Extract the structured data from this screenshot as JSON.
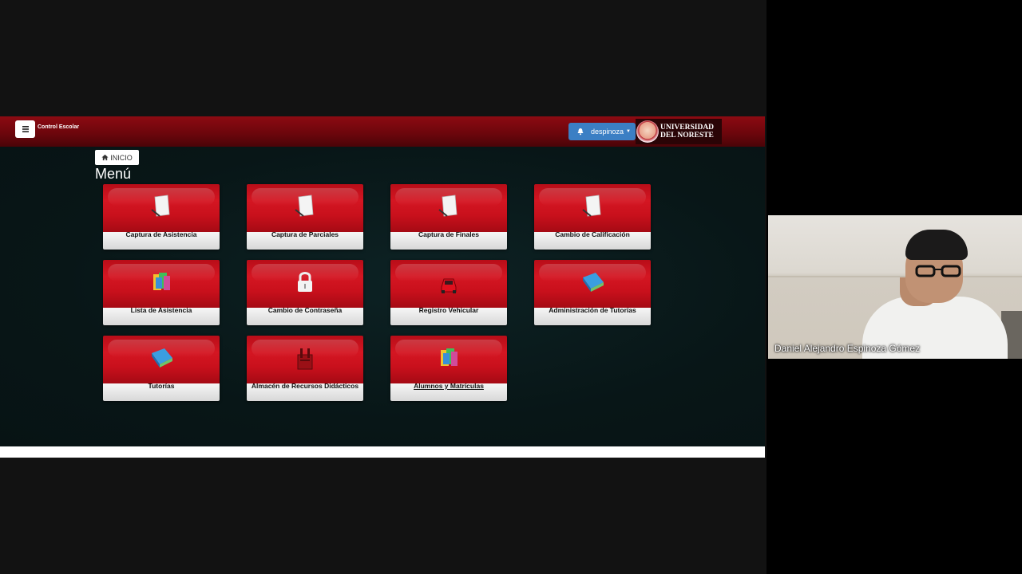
{
  "app": {
    "title": "Control Escolar",
    "user": "despinoza",
    "logo_lines": [
      "UNIVERSIDAD",
      "DEL NORESTE"
    ]
  },
  "breadcrumb": {
    "label": "INICIO"
  },
  "page_title": "Menú",
  "tiles": [
    {
      "label": "Captura de Asistencia",
      "icon": "document-pen-icon"
    },
    {
      "label": "Captura de Parciales",
      "icon": "document-pen-icon"
    },
    {
      "label": "Captura de Finales",
      "icon": "document-pen-icon"
    },
    {
      "label": "Cambio de Calificación",
      "icon": "document-pen-icon"
    },
    {
      "label": "Lista de Asistencia",
      "icon": "colored-binder-icon"
    },
    {
      "label": "Cambio de Contraseña",
      "icon": "padlock-icon"
    },
    {
      "label": "Registro Vehicular",
      "icon": "red-car-icon"
    },
    {
      "label": "Administración de Tutorías",
      "icon": "blue-book-icon"
    },
    {
      "label": "Tutorías",
      "icon": "blue-book-icon"
    },
    {
      "label": "Almacén de Recursos Didácticos",
      "icon": "tools-icon"
    },
    {
      "label": "Alumnos y Matrículas",
      "icon": "colored-binder-icon"
    }
  ],
  "video": {
    "participant_name": "Daniel Alejandro Espinoza Gómez"
  },
  "colors": {
    "topbar": "#7a0810",
    "tile_red": "#d41622",
    "user_button": "#3b7fc4",
    "content_bg": "#081617"
  }
}
